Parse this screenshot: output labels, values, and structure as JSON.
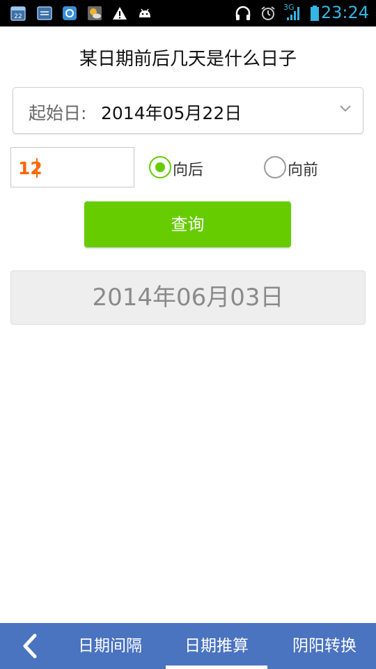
{
  "status_bar": {
    "time": "23:24",
    "network": "3G",
    "icons": [
      "calendar-icon",
      "message-icon",
      "app-icon",
      "weather-icon",
      "warning-icon",
      "android-icon",
      "headphones-icon",
      "alarm-icon",
      "signal-icon",
      "battery-icon"
    ]
  },
  "title": "某日期前后几天是什么日子",
  "start_date": {
    "label": "起始日:",
    "value": "2014年05月22日"
  },
  "days_input": {
    "value": "12"
  },
  "direction": {
    "options": [
      {
        "label": "向后",
        "selected": true
      },
      {
        "label": "向前",
        "selected": false
      }
    ]
  },
  "query_button": {
    "label": "查询"
  },
  "result": {
    "value": "2014年06月03日"
  },
  "bottom_nav": {
    "tabs": [
      {
        "label": "日期间隔",
        "active": false
      },
      {
        "label": "日期推算",
        "active": true
      },
      {
        "label": "阴阳转换",
        "active": false
      }
    ]
  },
  "colors": {
    "accent": "#66cc00",
    "nav_bg": "#4a73c0",
    "input_text": "#ff6600",
    "status_icon": "#33b5e5"
  }
}
